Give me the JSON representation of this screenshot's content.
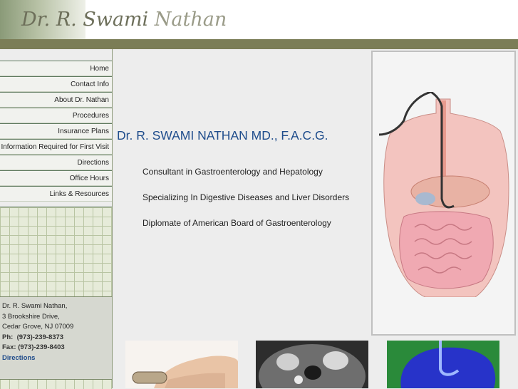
{
  "header": {
    "logo_text_1": "Dr. R. Swami",
    "logo_text_2": "Nathan"
  },
  "nav": {
    "items": [
      {
        "label": "Home"
      },
      {
        "label": "Contact Info"
      },
      {
        "label": "About Dr. Nathan"
      },
      {
        "label": "Procedures"
      },
      {
        "label": "Insurance Plans"
      },
      {
        "label": "Information Required for First Visit"
      },
      {
        "label": "Directions"
      },
      {
        "label": "Office Hours"
      },
      {
        "label": "Links & Resources"
      }
    ]
  },
  "address": {
    "name": "Dr. R. Swami Nathan,",
    "street": "3 Brookshire Drive,",
    "city": "Cedar Grove, NJ 07009",
    "phone_label": "Ph:",
    "phone": "(973)-239-8373",
    "fax_label": "Fax:",
    "fax": "(973)-239-8403",
    "directions_link": "Directions"
  },
  "main": {
    "title": "Dr. R. SWAMI NATHAN MD., F.A.C.G.",
    "bullets": [
      "Consultant in Gastroenterology and Hepatology",
      "Specializing In Digestive Diseases and Liver Disorders",
      "Diplomate of American Board of Gastroenterology"
    ]
  },
  "colors": {
    "olive": "#7b7d56",
    "title_blue": "#1f4d8c",
    "link_blue": "#1f4b8a"
  }
}
